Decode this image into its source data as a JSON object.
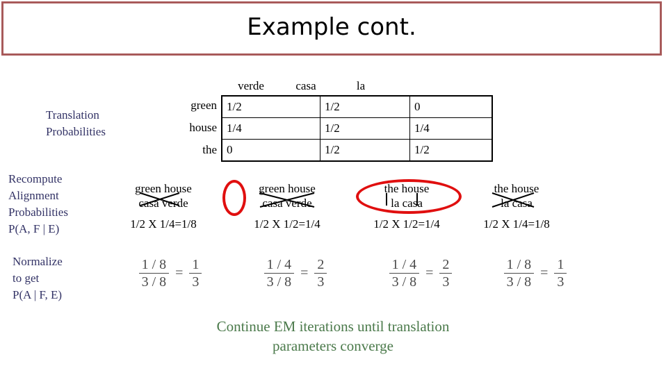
{
  "slide": {
    "title": "Example cont.",
    "title_border_color": "#a85a5a",
    "label_color": "#333366",
    "highlight_color": "#e00f0f",
    "footer_color": "#4b7a4b"
  },
  "sections": {
    "translation_label": "Translation\nProbabilities",
    "recompute_label": "Recompute\nAlignment\nProbabilities\nP(A, F | E)",
    "normalize_label": "Normalize\nto get\nP(A | F, E)"
  },
  "table": {
    "column_headers": [
      "verde",
      "casa",
      "la"
    ],
    "row_labels": [
      "green",
      "house",
      "the"
    ],
    "rows": [
      [
        "1/2",
        "1/2",
        "0"
      ],
      [
        "1/4",
        "1/2",
        "1/4"
      ],
      [
        "0",
        "1/2",
        "1/2"
      ]
    ]
  },
  "alignments": [
    {
      "english": "green house",
      "spanish": "casa verde",
      "product": "1/2 X 1/4=1/8",
      "crossed": true,
      "highlighted": false
    },
    {
      "english": "green house",
      "spanish": "casa verde",
      "product": "1/2 X 1/2=1/4",
      "crossed": true,
      "highlighted": true
    },
    {
      "english": "the house",
      "spanish": "la casa",
      "product": "1/2 X 1/2=1/4",
      "crossed": false,
      "highlighted": true
    },
    {
      "english": "the house",
      "spanish": "la casa",
      "product": "1/2 X 1/4=1/8",
      "crossed": true,
      "highlighted": false
    }
  ],
  "equations": [
    {
      "lhs_num": "1 / 8",
      "lhs_den": "3 / 8",
      "eq": "=",
      "rhs_num": "1",
      "rhs_den": "3"
    },
    {
      "lhs_num": "1 / 4",
      "lhs_den": "3 / 8",
      "eq": "=",
      "rhs_num": "2",
      "rhs_den": "3"
    },
    {
      "lhs_num": "1 / 4",
      "lhs_den": "3 / 8",
      "eq": "=",
      "rhs_num": "2",
      "rhs_den": "3"
    },
    {
      "lhs_num": "1 / 8",
      "lhs_den": "3 / 8",
      "eq": "=",
      "rhs_num": "1",
      "rhs_den": "3"
    }
  ],
  "footer": {
    "note": "Continue EM iterations until translation\nparameters converge"
  }
}
